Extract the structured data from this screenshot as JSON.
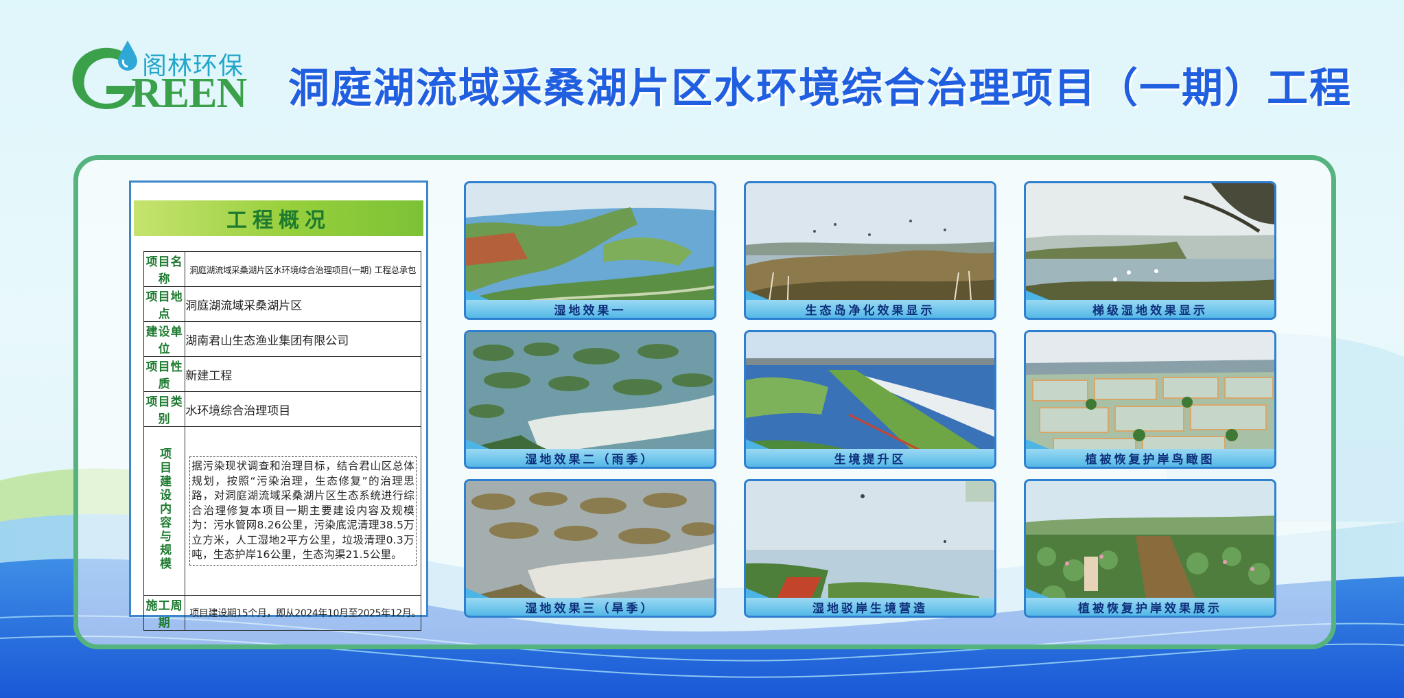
{
  "logo": {
    "cn": "阁林环保",
    "en": "REEN",
    "colors": {
      "green": "#3aa04a",
      "blue": "#22a6c9"
    }
  },
  "title": "洞庭湖流域采桑湖片区水环境综合治理项目（一期）工程",
  "overview": {
    "heading": "工程概况",
    "rows": [
      {
        "label": "项目名称",
        "value": "洞庭湖流域采桑湖片区水环境综合治理项目(一期) 工程总承包"
      },
      {
        "label": "项目地点",
        "value": "洞庭湖流域采桑湖片区"
      },
      {
        "label": "建设单位",
        "value": "湖南君山生态渔业集团有限公司"
      },
      {
        "label": "项目性质",
        "value": "新建工程"
      },
      {
        "label": "项目类别",
        "value": "水环境综合治理项目"
      }
    ],
    "content_label": "项目建设内容与规模",
    "content": "据污染现状调查和治理目标，结合君山区总体规划，按照“污染治理，生态修复”的治理思路，对洞庭湖流域采桑湖片区生态系统进行综合治理修复本项目一期主要建设内容及规模为：污水管网8.26公里，污染底泥清理38.5万立方米，人工湿地2平方公里，垃圾清理0.3万吨，生态护岸16公里，生态沟渠21.5公里。",
    "period_label": "施工周期",
    "period": "项目建设期15个月，即从2024年10月至2025年12月。"
  },
  "tiles": [
    {
      "caption": "湿地效果一"
    },
    {
      "caption": "生态岛净化效果显示"
    },
    {
      "caption": "梯级湿地效果显示"
    },
    {
      "caption": "湿地效果二（雨季）"
    },
    {
      "caption": "生境提升区"
    },
    {
      "caption": "植被恢复护岸鸟瞰图"
    },
    {
      "caption": "湿地效果三（旱季）"
    },
    {
      "caption": "湿地驳岸生境营造"
    },
    {
      "caption": "植被恢复护岸效果展示"
    }
  ]
}
